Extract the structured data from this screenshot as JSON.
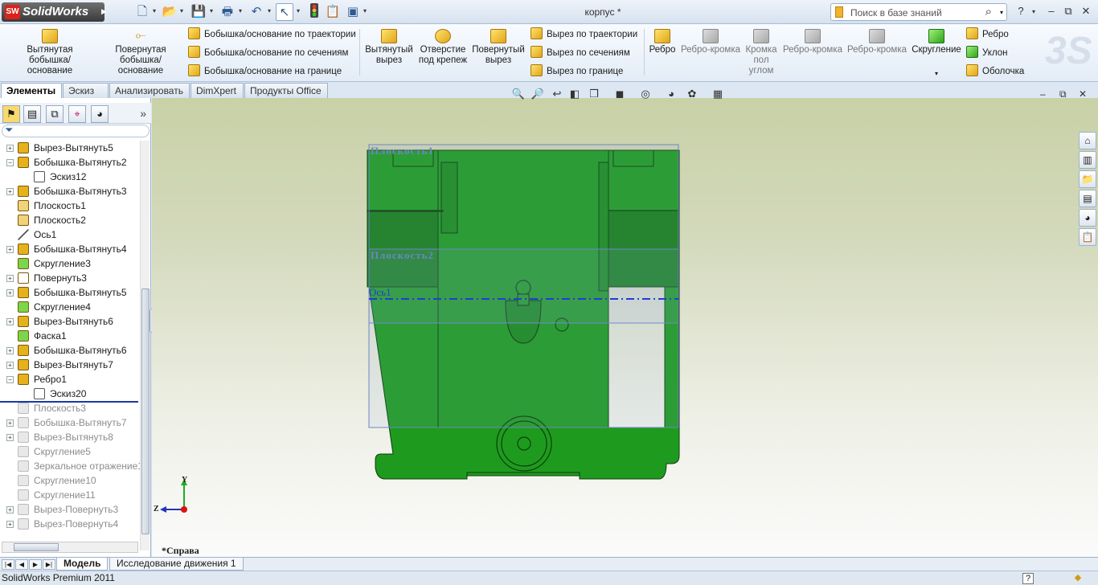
{
  "app": {
    "logo_text": "SolidWorks",
    "doc_title": "корпус *"
  },
  "search": {
    "placeholder": "Поиск в базе знаний"
  },
  "ribbon": {
    "extrude_boss": "Вытянутая бобышка/основание",
    "revolve_boss": "Повернутая бобышка/основание",
    "sweep_boss": "Бобышка/основание по траектории",
    "loft_boss": "Бобышка/основание по сечениям",
    "boundary_boss": "Бобышка/основание на границе",
    "extrude_cut": "Вытянутый вырез",
    "hole_wizard": "Отверстие под крепеж",
    "revolve_cut": "Повернутый вырез",
    "sweep_cut": "Вырез по траектории",
    "loft_cut": "Вырез по сечениям",
    "boundary_cut": "Вырез по границе",
    "rib_big": "Ребро",
    "rib_edge1": "Ребро-кромка",
    "edge_angle": "Кромка пол углом",
    "rib_edge2": "Ребро-кромка",
    "rib_edge3": "Ребро-кромка",
    "fillet": "Скругление",
    "rib_small": "Ребро",
    "draft": "Уклон",
    "shell": "Оболочка"
  },
  "tabs": [
    "Элементы",
    "Эскиз",
    "Анализировать",
    "DimXpert",
    "Продукты Office"
  ],
  "tree": [
    {
      "label": "Вырез-Вытянуть5",
      "icon": "cut-extrude-icon",
      "exp": "+",
      "indent": 0,
      "sup": false
    },
    {
      "label": "Бобышка-Вытянуть2",
      "icon": "boss-extrude-icon",
      "exp": "-",
      "indent": 0,
      "sup": false
    },
    {
      "label": "Эскиз12",
      "icon": "sketch-icon",
      "exp": "",
      "indent": 1,
      "sup": false
    },
    {
      "label": "Бобышка-Вытянуть3",
      "icon": "boss-extrude-icon",
      "exp": "+",
      "indent": 0,
      "sup": false
    },
    {
      "label": "Плоскость1",
      "icon": "plane-icon",
      "exp": "",
      "indent": 0,
      "sup": false
    },
    {
      "label": "Плоскость2",
      "icon": "plane-icon",
      "exp": "",
      "indent": 0,
      "sup": false
    },
    {
      "label": "Ось1",
      "icon": "axis-icon",
      "exp": "",
      "indent": 0,
      "sup": false
    },
    {
      "label": "Бобышка-Вытянуть4",
      "icon": "boss-extrude-icon",
      "exp": "+",
      "indent": 0,
      "sup": false
    },
    {
      "label": "Скругление3",
      "icon": "fillet-icon",
      "exp": "",
      "indent": 0,
      "sup": false
    },
    {
      "label": "Повернуть3",
      "icon": "revolve-icon",
      "exp": "+",
      "indent": 0,
      "sup": false
    },
    {
      "label": "Бобышка-Вытянуть5",
      "icon": "boss-extrude-icon",
      "exp": "+",
      "indent": 0,
      "sup": false
    },
    {
      "label": "Скругление4",
      "icon": "fillet-icon",
      "exp": "",
      "indent": 0,
      "sup": false
    },
    {
      "label": "Вырез-Вытянуть6",
      "icon": "cut-extrude-icon",
      "exp": "+",
      "indent": 0,
      "sup": false
    },
    {
      "label": "Фаска1",
      "icon": "chamfer-icon",
      "exp": "",
      "indent": 0,
      "sup": false
    },
    {
      "label": "Бобышка-Вытянуть6",
      "icon": "boss-extrude-icon",
      "exp": "+",
      "indent": 0,
      "sup": false
    },
    {
      "label": "Вырез-Вытянуть7",
      "icon": "cut-extrude-icon",
      "exp": "+",
      "indent": 0,
      "sup": false
    },
    {
      "label": "Ребро1",
      "icon": "rib-icon",
      "exp": "-",
      "indent": 0,
      "sup": false
    },
    {
      "label": "Эскиз20",
      "icon": "sketch-icon",
      "exp": "",
      "indent": 1,
      "sup": false
    },
    {
      "label": "Плоскость3",
      "icon": "plane-icon",
      "exp": "",
      "indent": 0,
      "sup": true
    },
    {
      "label": "Бобышка-Вытянуть7",
      "icon": "boss-extrude-icon",
      "exp": "+",
      "indent": 0,
      "sup": true
    },
    {
      "label": "Вырез-Вытянуть8",
      "icon": "cut-extrude-icon",
      "exp": "+",
      "indent": 0,
      "sup": true
    },
    {
      "label": "Скругление5",
      "icon": "fillet-icon",
      "exp": "",
      "indent": 0,
      "sup": true
    },
    {
      "label": "Зеркальное отражение1",
      "icon": "mirror-icon",
      "exp": "",
      "indent": 0,
      "sup": true
    },
    {
      "label": "Скругление10",
      "icon": "fillet-icon",
      "exp": "",
      "indent": 0,
      "sup": true
    },
    {
      "label": "Скругление11",
      "icon": "fillet-icon",
      "exp": "",
      "indent": 0,
      "sup": true
    },
    {
      "label": "Вырез-Повернуть3",
      "icon": "revolve-cut-icon",
      "exp": "+",
      "indent": 0,
      "sup": true
    },
    {
      "label": "Вырез-Повернуть4",
      "icon": "revolve-cut-icon",
      "exp": "+",
      "indent": 0,
      "sup": true
    }
  ],
  "model": {
    "plane1_label": "Плоскость1",
    "plane2_label": "Плоскость2",
    "axis_label": "Ось1",
    "color": "#1e9b1e"
  },
  "triad": {
    "y": "Y",
    "z": "Z"
  },
  "view_label": "*Справа",
  "bottom_tabs": {
    "model": "Модель",
    "motion": "Исследование движения 1"
  },
  "status": {
    "text": "SolidWorks Premium 2011",
    "help": "?"
  }
}
